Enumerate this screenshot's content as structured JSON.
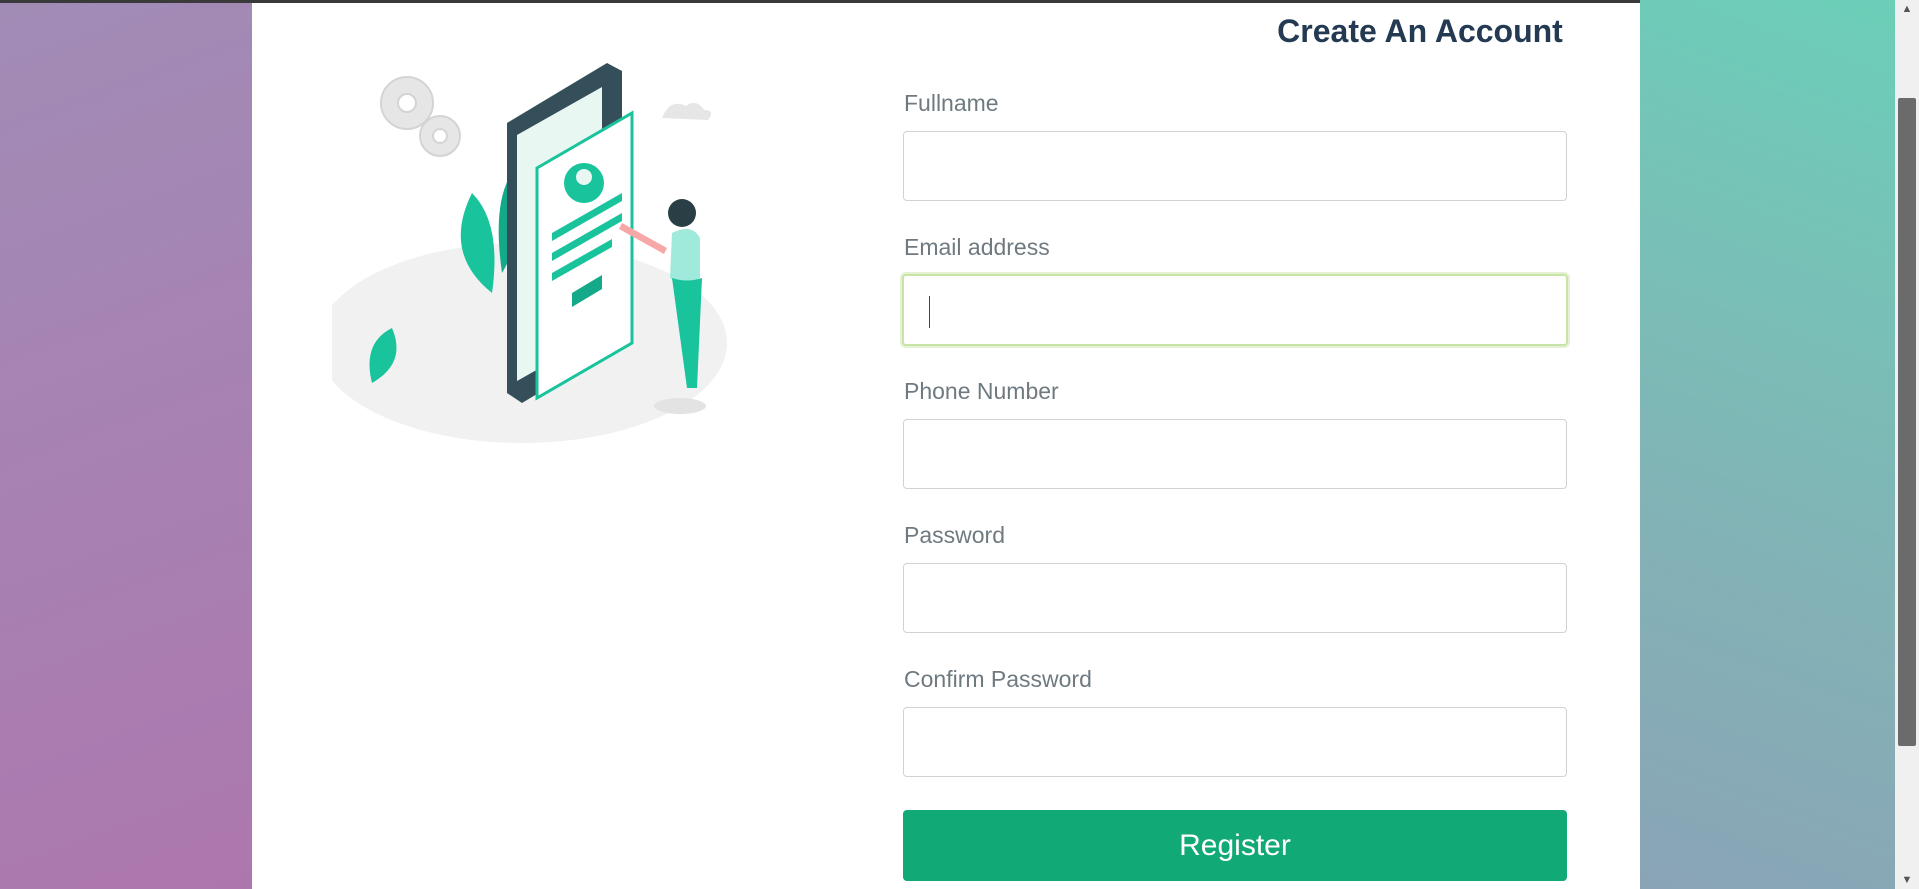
{
  "page": {
    "title": "Create An Account"
  },
  "form": {
    "fields": [
      {
        "label": "Fullname",
        "value": ""
      },
      {
        "label": "Email address",
        "value": ""
      },
      {
        "label": "Phone Number",
        "value": ""
      },
      {
        "label": "Password",
        "value": ""
      },
      {
        "label": "Confirm Password",
        "value": ""
      }
    ],
    "register_label": "Register"
  },
  "scrollbar": {
    "up_glyph": "▲",
    "down_glyph": "▼"
  },
  "colors": {
    "accent": "#11a975",
    "title": "#243a52",
    "focus_border": "#c9e4a8",
    "illustration_green": "#19c39c"
  },
  "icons": [
    "gear-icon",
    "cloud-icon",
    "profile-card-illustration"
  ]
}
